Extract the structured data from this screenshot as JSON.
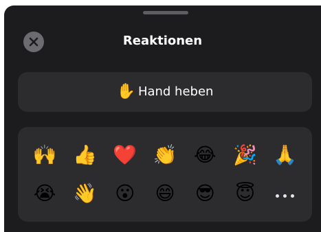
{
  "header": {
    "title": "Reaktionen",
    "close_icon": "close-icon"
  },
  "raise_hand": {
    "emoji": "✋",
    "label": "Hand heben"
  },
  "reactions": {
    "row1": [
      "🙌",
      "👍",
      "❤️",
      "👏",
      "😂",
      "🎉",
      "🙏"
    ],
    "row2": [
      "😭",
      "👋",
      "😮",
      "😄",
      "😎",
      "😇"
    ],
    "more_icon": "more-icon"
  },
  "colors": {
    "sheet_background": "#1c1c1e",
    "panel_background": "#2c2c2e",
    "close_button": "#6b6b70",
    "text": "#ffffff"
  }
}
